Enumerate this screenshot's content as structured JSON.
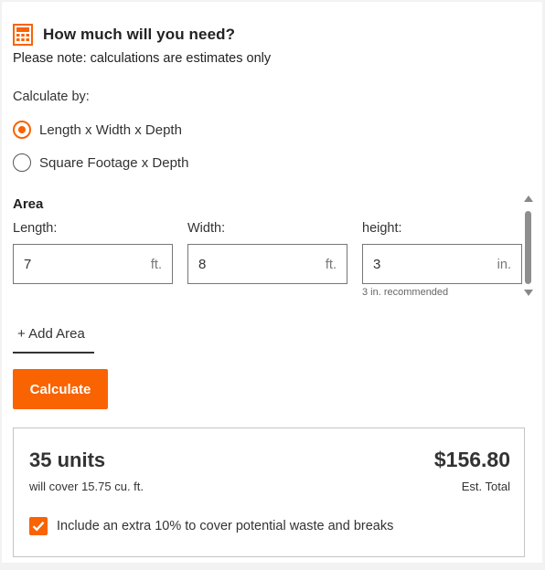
{
  "header": {
    "title": "How much will you need?",
    "note": "Please note: calculations are estimates only",
    "icon": "calculator-icon",
    "accent_color": "#f96302"
  },
  "calculate_by": {
    "label": "Calculate by:",
    "options": [
      {
        "label": "Length x Width x Depth",
        "selected": true
      },
      {
        "label": "Square Footage x Depth",
        "selected": false
      }
    ]
  },
  "area": {
    "title": "Area",
    "fields": [
      {
        "label": "Length:",
        "value": "7",
        "unit": "ft."
      },
      {
        "label": "Width:",
        "value": "8",
        "unit": "ft."
      },
      {
        "label": "height:",
        "value": "3",
        "unit": "in.",
        "hint": "3 in. recommended"
      }
    ]
  },
  "add_area_label": "+ Add Area",
  "calculate_label": "Calculate",
  "result": {
    "units": "35 units",
    "coverage": "will cover 15.75 cu. ft.",
    "price": "$156.80",
    "price_label": "Est. Total",
    "extra_label": "Include an extra 10% to cover potential waste and breaks",
    "extra_checked": true
  }
}
